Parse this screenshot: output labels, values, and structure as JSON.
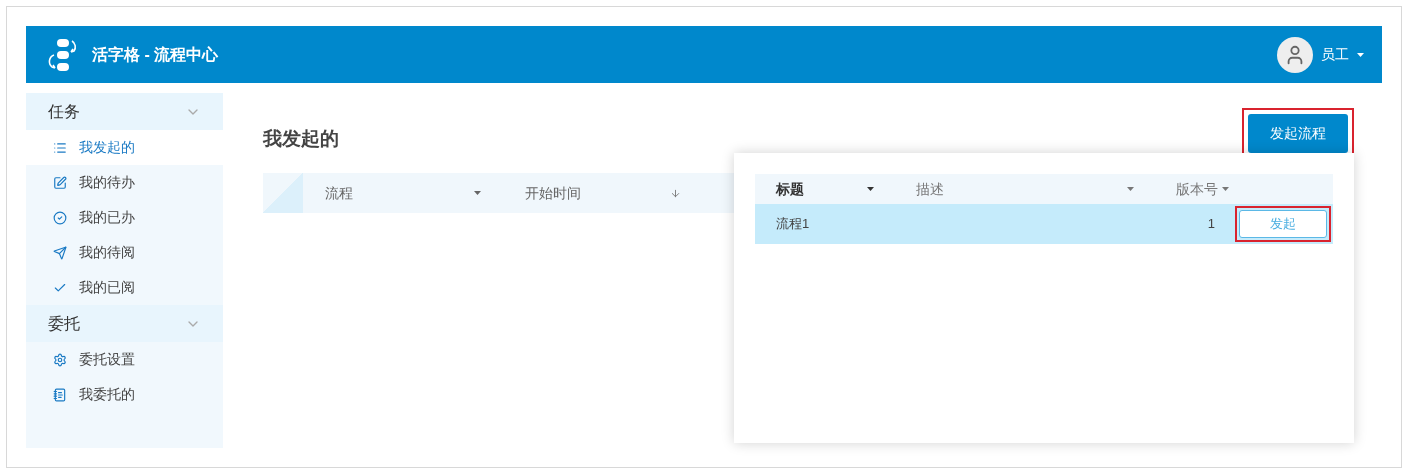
{
  "header": {
    "title": "活字格 - 流程中心",
    "user": "员工"
  },
  "sidebar": {
    "groups": [
      {
        "title": "任务",
        "expanded": true,
        "items": [
          {
            "label": "我发起的",
            "selected": true
          },
          {
            "label": "我的待办",
            "selected": false
          },
          {
            "label": "我的已办",
            "selected": false
          },
          {
            "label": "我的待阅",
            "selected": false
          },
          {
            "label": "我的已阅",
            "selected": false
          }
        ]
      },
      {
        "title": "委托",
        "expanded": true,
        "items": [
          {
            "label": "委托设置",
            "selected": false
          },
          {
            "label": "我委托的",
            "selected": false
          }
        ]
      }
    ]
  },
  "page": {
    "title": "我发起的",
    "start_button": {
      "label": "发起流程",
      "highlighted": true
    },
    "table": {
      "columns": [
        {
          "label": "流程",
          "kind": "menu"
        },
        {
          "label": "开始时间",
          "kind": "sorted"
        }
      ]
    }
  },
  "popup": {
    "columns": [
      {
        "label": "标题",
        "bold": true
      },
      {
        "label": "描述",
        "bold": false
      },
      {
        "label": "版本号",
        "bold": false
      }
    ],
    "rows": [
      {
        "title": "流程1",
        "version": "1",
        "selected": true,
        "action": {
          "label": "发起",
          "highlighted": true
        }
      }
    ]
  }
}
